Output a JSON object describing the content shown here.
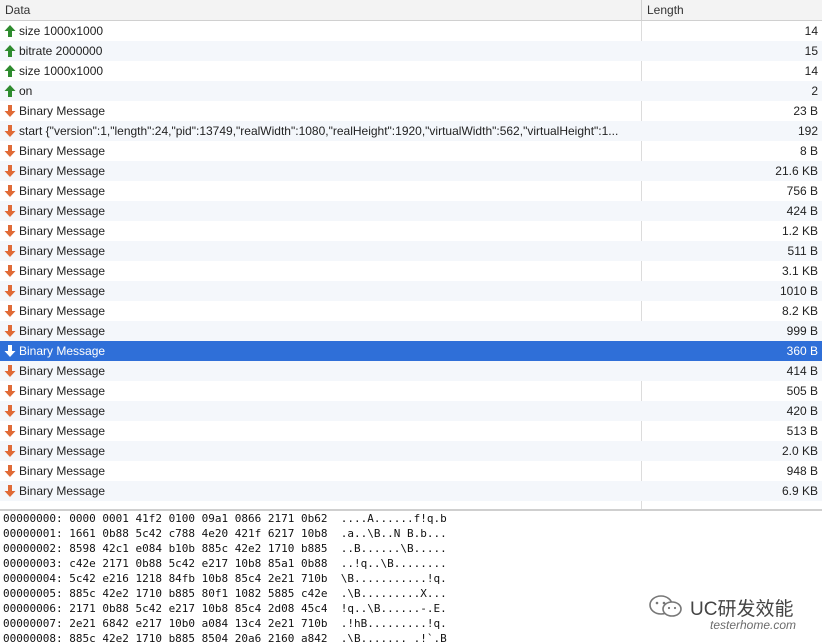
{
  "columns": {
    "data": "Data",
    "length": "Length"
  },
  "colors": {
    "sent": "#2e8b2e",
    "received": "#e06a36",
    "selected": "#2f6fd8"
  },
  "messages": [
    {
      "direction": "sent",
      "icon": "up-arrow-icon",
      "data": "size 1000x1000",
      "length": "14"
    },
    {
      "direction": "sent",
      "icon": "up-arrow-icon",
      "data": "bitrate 2000000",
      "length": "15"
    },
    {
      "direction": "sent",
      "icon": "up-arrow-icon",
      "data": "size 1000x1000",
      "length": "14"
    },
    {
      "direction": "sent",
      "icon": "up-arrow-icon",
      "data": "on",
      "length": "2"
    },
    {
      "direction": "received",
      "icon": "down-arrow-icon",
      "data": "Binary Message",
      "length": "23 B"
    },
    {
      "direction": "received",
      "icon": "down-arrow-icon",
      "data": "start {\"version\":1,\"length\":24,\"pid\":13749,\"realWidth\":1080,\"realHeight\":1920,\"virtualWidth\":562,\"virtualHeight\":1...",
      "length": "192"
    },
    {
      "direction": "received",
      "icon": "down-arrow-icon",
      "data": "Binary Message",
      "length": "8 B"
    },
    {
      "direction": "received",
      "icon": "down-arrow-icon",
      "data": "Binary Message",
      "length": "21.6 KB"
    },
    {
      "direction": "received",
      "icon": "down-arrow-icon",
      "data": "Binary Message",
      "length": "756 B"
    },
    {
      "direction": "received",
      "icon": "down-arrow-icon",
      "data": "Binary Message",
      "length": "424 B"
    },
    {
      "direction": "received",
      "icon": "down-arrow-icon",
      "data": "Binary Message",
      "length": "1.2 KB"
    },
    {
      "direction": "received",
      "icon": "down-arrow-icon",
      "data": "Binary Message",
      "length": "511 B"
    },
    {
      "direction": "received",
      "icon": "down-arrow-icon",
      "data": "Binary Message",
      "length": "3.1 KB"
    },
    {
      "direction": "received",
      "icon": "down-arrow-icon",
      "data": "Binary Message",
      "length": "1010 B"
    },
    {
      "direction": "received",
      "icon": "down-arrow-icon",
      "data": "Binary Message",
      "length": "8.2 KB"
    },
    {
      "direction": "received",
      "icon": "down-arrow-icon",
      "data": "Binary Message",
      "length": "999 B"
    },
    {
      "direction": "received",
      "icon": "down-arrow-icon",
      "data": "Binary Message",
      "length": "360 B",
      "selected": true
    },
    {
      "direction": "received",
      "icon": "down-arrow-icon",
      "data": "Binary Message",
      "length": "414 B"
    },
    {
      "direction": "received",
      "icon": "down-arrow-icon",
      "data": "Binary Message",
      "length": "505 B"
    },
    {
      "direction": "received",
      "icon": "down-arrow-icon",
      "data": "Binary Message",
      "length": "420 B"
    },
    {
      "direction": "received",
      "icon": "down-arrow-icon",
      "data": "Binary Message",
      "length": "513 B"
    },
    {
      "direction": "received",
      "icon": "down-arrow-icon",
      "data": "Binary Message",
      "length": "2.0 KB"
    },
    {
      "direction": "received",
      "icon": "down-arrow-icon",
      "data": "Binary Message",
      "length": "948 B"
    },
    {
      "direction": "received",
      "icon": "down-arrow-icon",
      "data": "Binary Message",
      "length": "6.9 KB"
    }
  ],
  "hexdump": [
    "00000000: 0000 0001 41f2 0100 09a1 0866 2171 0b62  ....A......f!q.b",
    "00000001: 1661 0b88 5c42 c788 4e20 421f 6217 10b8  .a..\\B..N B.b...",
    "00000002: 8598 42c1 e084 b10b 885c 42e2 1710 b885  ..B......\\B.....",
    "00000003: c42e 2171 0b88 5c42 e217 10b8 85a1 0b88  ..!q..\\B........",
    "00000004: 5c42 e216 1218 84fb 10b8 85c4 2e21 710b  \\B...........!q.",
    "00000005: 885c 42e2 1710 b885 80f1 1082 5885 c42e  .\\B.........X...",
    "00000006: 2171 0b88 5c42 e217 10b8 85c4 2d08 45c4  !q..\\B......-.E.",
    "00000007: 2e21 6842 e217 10b0 a084 13c4 2e21 710b  .!hB.........!q.",
    "00000008: 885c 42e2 1710 b885 8504 20a6 2160 a842  .\\B....... .!`.B"
  ],
  "watermark": {
    "title": "UC研发效能",
    "site": "testerhome.com"
  }
}
